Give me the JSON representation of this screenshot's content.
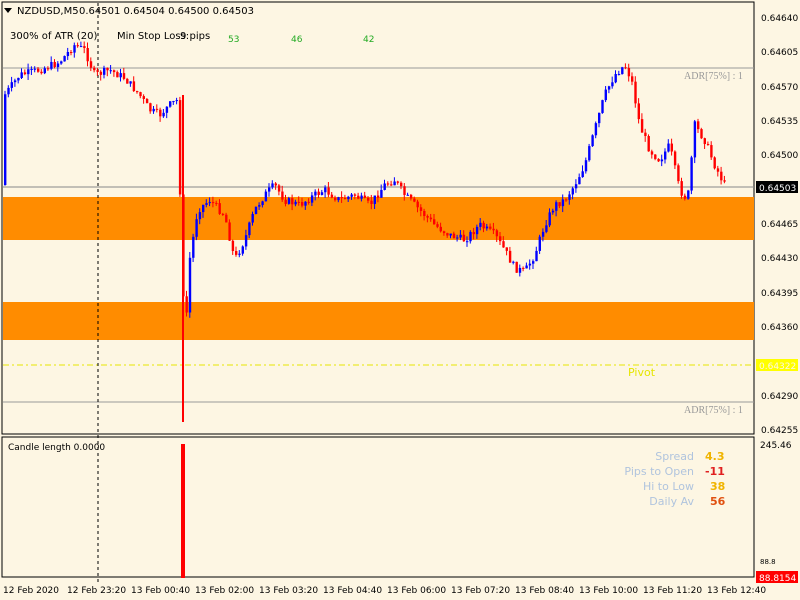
{
  "header": {
    "symbol": "NZDUSD,M5",
    "ohlc": "0.64501 0.64504 0.64500 0.64503"
  },
  "atr_info": {
    "label": "300% of ATR (20)",
    "min_stop_label": "Min Stop Loss:",
    "min_stop_value": "9 pips",
    "values": [
      "53",
      "46",
      "42"
    ]
  },
  "price_axis": {
    "ticks": [
      "0.64640",
      "0.64605",
      "0.64570",
      "0.64535",
      "0.64500",
      "0.64465",
      "0.64430",
      "0.64395",
      "0.64360",
      "0.64325",
      "0.64290",
      "0.64255"
    ],
    "current_price": "0.64503",
    "pivot_price": "0.64322"
  },
  "levels": {
    "adr_upper": "ADR[75%] : 1",
    "adr_lower": "ADR[75%] : 1",
    "pivot": "Pivot"
  },
  "time_axis": {
    "labels": [
      "12 Feb 2020",
      "12 Feb 23:20",
      "13 Feb 00:40",
      "13 Feb 02:00",
      "13 Feb 03:20",
      "13 Feb 04:40",
      "13 Feb 06:00",
      "13 Feb 07:20",
      "13 Feb 08:40",
      "13 Feb 10:00",
      "13 Feb 11:20",
      "13 Feb 12:40"
    ]
  },
  "sub_window": {
    "title": "Candle length 0.0000",
    "axis_top": "245.46",
    "axis_bottom_label": "88.8",
    "axis_bottom_highlight": "88.8154",
    "stats": [
      {
        "label": "Spread",
        "value": "4.3",
        "color": "#f0b400"
      },
      {
        "label": "Pips to Open",
        "value": "-11",
        "color": "#e02020"
      },
      {
        "label": "Hi to Low",
        "value": "38",
        "color": "#f0b400"
      },
      {
        "label": "Daily Av",
        "value": "56",
        "color": "#e05010"
      }
    ]
  },
  "colors": {
    "background": "#fdf6e3",
    "zone": "#ff8c00",
    "bull": "#0000ff",
    "bear": "#ff0000",
    "pivot": "#ffff00",
    "price_label_bg": "#000000",
    "histogram": "#ff0000"
  },
  "icons": {
    "collapse": "triangle-down-icon"
  }
}
